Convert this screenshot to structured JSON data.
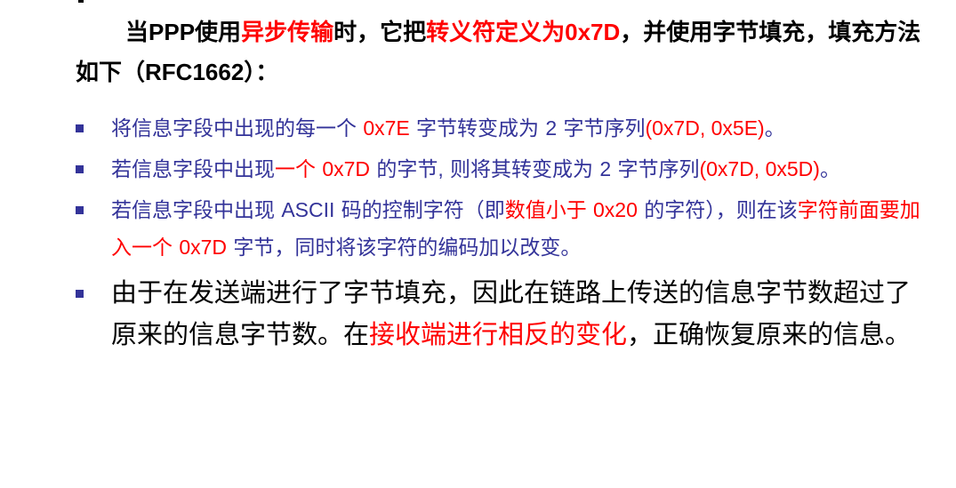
{
  "intro": {
    "seg1": "当",
    "seg2": "PPP",
    "seg3": "使用",
    "seg4": "异步传输",
    "seg5": "时，它把",
    "seg6": "转义符定义为",
    "seg7": "0x7D",
    "seg8": "，并使用字节填充，填充方法如下（",
    "seg9": "RFC1662",
    "seg10": "）："
  },
  "bullets": [
    {
      "segs": [
        "将信息字段中出现的每一个 ",
        "0x7E",
        " 字节转变成为 ",
        "2",
        " 字节序列",
        "(0x7D, 0x5E)",
        "。"
      ]
    },
    {
      "segs": [
        "若信息字段中出现",
        "一个",
        " ",
        "0x7D",
        " 的字节",
        ",",
        " 则将其转变成为 ",
        "2",
        " 字节序列",
        "(0x7D, 0x5D)",
        "。"
      ]
    },
    {
      "segs": [
        "若信息字段中出现 ",
        "ASCII",
        " 码的控制字符（即",
        "数值小于 ",
        "0x20",
        " 的字符），则在该",
        "字符前面要加入一个 ",
        "0x7D",
        " 字节，同时将该字符的编码加以改变。"
      ]
    },
    {
      "segs": [
        "由于在发送端进行了字节填充，因此在链路上传送的信息字节数超过了原来的信息字节数。在",
        "接收端进行相反的变化",
        "，正确恢复原来的信息。"
      ]
    }
  ],
  "colors": {
    "accent_red": "#ff0000",
    "bullet_blue": "#333399",
    "text_black": "#000000"
  }
}
